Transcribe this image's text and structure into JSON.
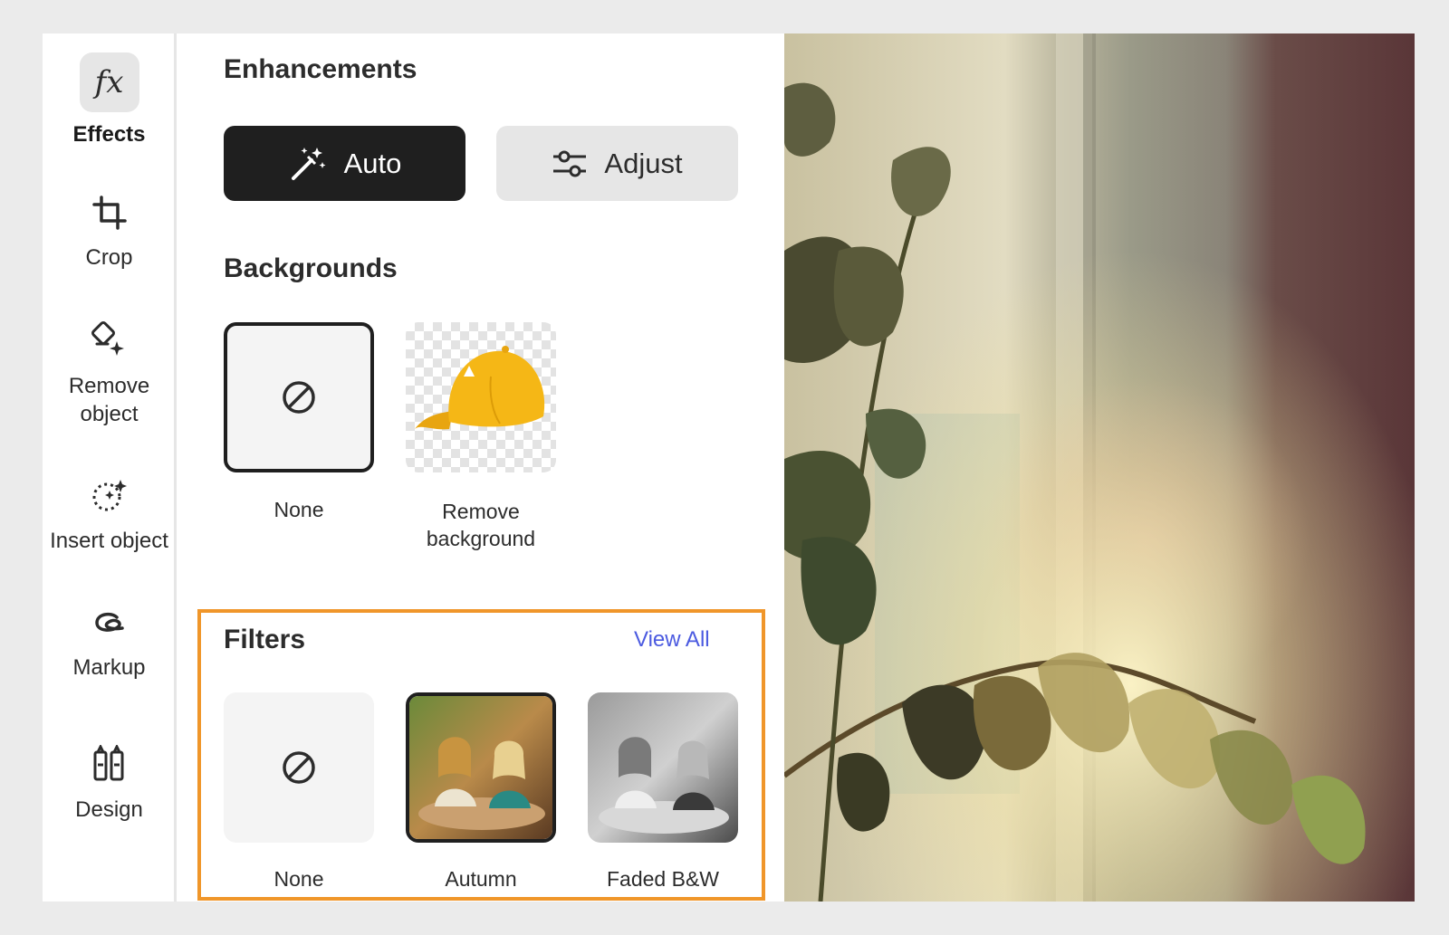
{
  "rail": {
    "items": [
      {
        "label": "Effects",
        "icon": "fx-icon",
        "active": true
      },
      {
        "label": "Crop",
        "icon": "crop-icon"
      },
      {
        "label": "Remove\nobject",
        "icon": "remove-object-icon"
      },
      {
        "label": "Insert object",
        "icon": "insert-object-icon"
      },
      {
        "label": "Markup",
        "icon": "markup-icon"
      },
      {
        "label": "Design",
        "icon": "design-icon"
      }
    ]
  },
  "enhancements": {
    "title": "Enhancements",
    "auto_label": "Auto",
    "adjust_label": "Adjust"
  },
  "backgrounds": {
    "title": "Backgrounds",
    "items": [
      {
        "label": "None",
        "selected": true
      },
      {
        "label": "Remove background"
      }
    ]
  },
  "filters": {
    "title": "Filters",
    "view_all": "View All",
    "items": [
      {
        "label": "None"
      },
      {
        "label": "Autumn",
        "selected": true
      },
      {
        "label": "Faded B&W"
      }
    ]
  },
  "colors": {
    "accent_highlight": "#f0962a",
    "link": "#4b5ae0",
    "primary_button": "#1f1f1f",
    "cap_yellow": "#f5b716"
  }
}
